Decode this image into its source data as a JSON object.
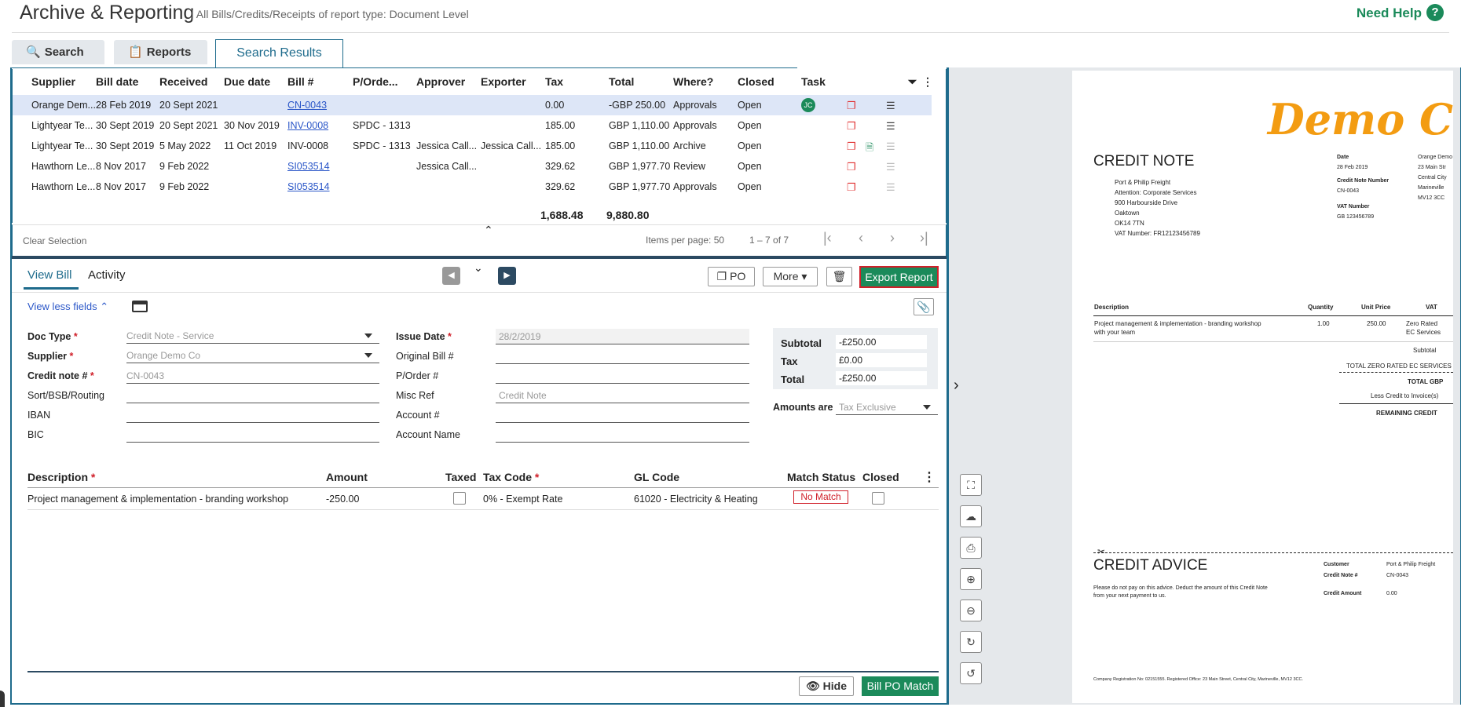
{
  "header": {
    "title": "Archive & Reporting",
    "subtitle": "| All Bills/Credits/Receipts of report type: Document Level",
    "help": "Need Help",
    "help_icon": "?"
  },
  "tabs": [
    {
      "label": "Search",
      "icon": "search-icon"
    },
    {
      "label": "Reports",
      "icon": "clipboard-icon"
    },
    {
      "label": "Search Results"
    }
  ],
  "grid": {
    "columns": [
      "Supplier",
      "Bill date",
      "Received",
      "Due date",
      "Bill #",
      "P/Orde...",
      "Approver",
      "Exporter",
      "Tax",
      "Total",
      "Where?",
      "Closed",
      "Task"
    ],
    "rows": [
      {
        "supplier": "Orange Dem...",
        "bill_date": "28 Feb 2019",
        "received": "20 Sept 2021",
        "due": "",
        "bill": "CN-0043",
        "po": "",
        "approver": "",
        "exporter": "",
        "tax": "0.00",
        "total": "-GBP 250.00",
        "where": "Approvals",
        "closed": "Open",
        "task": "JC"
      },
      {
        "supplier": "Lightyear Te...",
        "bill_date": "30 Sept 2019",
        "received": "20 Sept 2021",
        "due": "30 Nov 2019",
        "bill": "INV-0008",
        "po": "SPDC - 1313",
        "approver": "",
        "exporter": "",
        "tax": "185.00",
        "total": "GBP 1,110.00",
        "where": "Approvals",
        "closed": "Open",
        "task": ""
      },
      {
        "supplier": "Lightyear Te...",
        "bill_date": "30 Sept 2019",
        "received": "5 May 2022",
        "due": "11 Oct 2019",
        "bill": "INV-0008",
        "po": "SPDC - 1313",
        "approver": "Jessica Call...",
        "exporter": "Jessica Call...",
        "tax": "185.00",
        "total": "GBP 1,110.00",
        "where": "Archive",
        "closed": "Open",
        "task": ""
      },
      {
        "supplier": "Hawthorn Le...",
        "bill_date": "8 Nov 2017",
        "received": "9 Feb 2022",
        "due": "",
        "bill": "SI053514",
        "po": "",
        "approver": "Jessica Call...",
        "exporter": "",
        "tax": "329.62",
        "total": "GBP 1,977.70",
        "where": "Review",
        "closed": "Open",
        "task": ""
      },
      {
        "supplier": "Hawthorn Le...",
        "bill_date": "8 Nov 2017",
        "received": "9 Feb 2022",
        "due": "",
        "bill": "SI053514",
        "po": "",
        "approver": "",
        "exporter": "",
        "tax": "329.62",
        "total": "GBP 1,977.70",
        "where": "Approvals",
        "closed": "Open",
        "task": ""
      }
    ],
    "tax_total": "1,688.48",
    "grand_total": "9,880.80"
  },
  "pagination": {
    "clear": "Clear Selection",
    "items_per_page": "Items per page: 50",
    "range": "1 – 7 of 7"
  },
  "bill": {
    "tab_view": "View Bill",
    "tab_activity": "Activity",
    "po_btn": "PO",
    "more_btn": "More",
    "export_btn": "Export Report",
    "view_less": "View less fields"
  },
  "form": {
    "doc_type_label": "Doc Type",
    "doc_type": "Credit Note - Service",
    "supplier_label": "Supplier",
    "supplier": "Orange Demo Co",
    "credit_label": "Credit note #",
    "credit": "CN-0043",
    "sort_label": "Sort/BSB/Routing",
    "iban_label": "IBAN",
    "bic_label": "BIC",
    "issue_label": "Issue Date",
    "issue": "28/2/2019",
    "orig_label": "Original Bill #",
    "po_label": "P/Order #",
    "misc_label": "Misc Ref",
    "misc": "Credit Note",
    "account_label": "Account #",
    "account_name_label": "Account Name",
    "subtotal_label": "Subtotal",
    "subtotal": "-£250.00",
    "tax_label": "Tax",
    "tax": "£0.00",
    "total_label": "Total",
    "total": "-£250.00",
    "amounts_label": "Amounts are",
    "amounts": "Tax Exclusive"
  },
  "lines": {
    "headers": {
      "desc": "Description",
      "amount": "Amount",
      "taxed": "Taxed",
      "taxcode": "Tax Code",
      "gl": "GL Code",
      "match": "Match Status",
      "closed": "Closed"
    },
    "row": {
      "desc": "Project management & implementation - branding workshop",
      "amount": "-250.00",
      "taxcode": "0% - Exempt Rate",
      "gl": "61020 - Electricity & Heating",
      "match": "No Match"
    }
  },
  "footer": {
    "hide": "Hide",
    "bpm": "Bill PO Match"
  },
  "doc": {
    "logo": "Demo C",
    "title": "CREDIT NOTE",
    "to": [
      "Port & Philip Freight",
      "Attention: Corporate Services",
      "900 Harbourside Drive",
      "Oaktown",
      "OK14 7TN",
      "VAT Number: FR12123456789"
    ],
    "date_label": "Date",
    "date": "28 Feb 2019",
    "cn_label": "Credit Note Number",
    "cn": "CN-0043",
    "vat_label": "VAT Number",
    "vat": "GB 123456789",
    "from": [
      "Orange Demo",
      "23 Main Str",
      "Central City",
      "Marineville",
      "MV12 3CC"
    ],
    "th": {
      "desc": "Description",
      "qty": "Quantity",
      "price": "Unit Price",
      "vat": "VAT"
    },
    "line1": "Project management & implementation - branding workshop",
    "line2": "with your team",
    "qty": "1.00",
    "price": "250.00",
    "vatv1": "Zero Rated",
    "vatv2": "EC Services",
    "subtotal": "Subtotal",
    "total_zero": "TOTAL ZERO RATED EC SERVICES",
    "total_gbp": "TOTAL GBP",
    "less": "Less Credit to Invoice(s)",
    "remaining": "REMAINING CREDIT",
    "advice": "CREDIT ADVICE",
    "advice_text1": "Please do not pay on this advice. Deduct the amount of this Credit Note",
    "advice_text2": "from your next payment to us.",
    "customer_label": "Customer",
    "customer": "Port & Philip Freight",
    "cnn_label": "Credit Note #",
    "cnn": "CN-0043",
    "amount_label": "Credit Amount",
    "amount": "0.00",
    "footer": "Company Registration No: 02151555. Registered Office: 23 Main Street, Central City, Marineville, MV12 3CC."
  }
}
